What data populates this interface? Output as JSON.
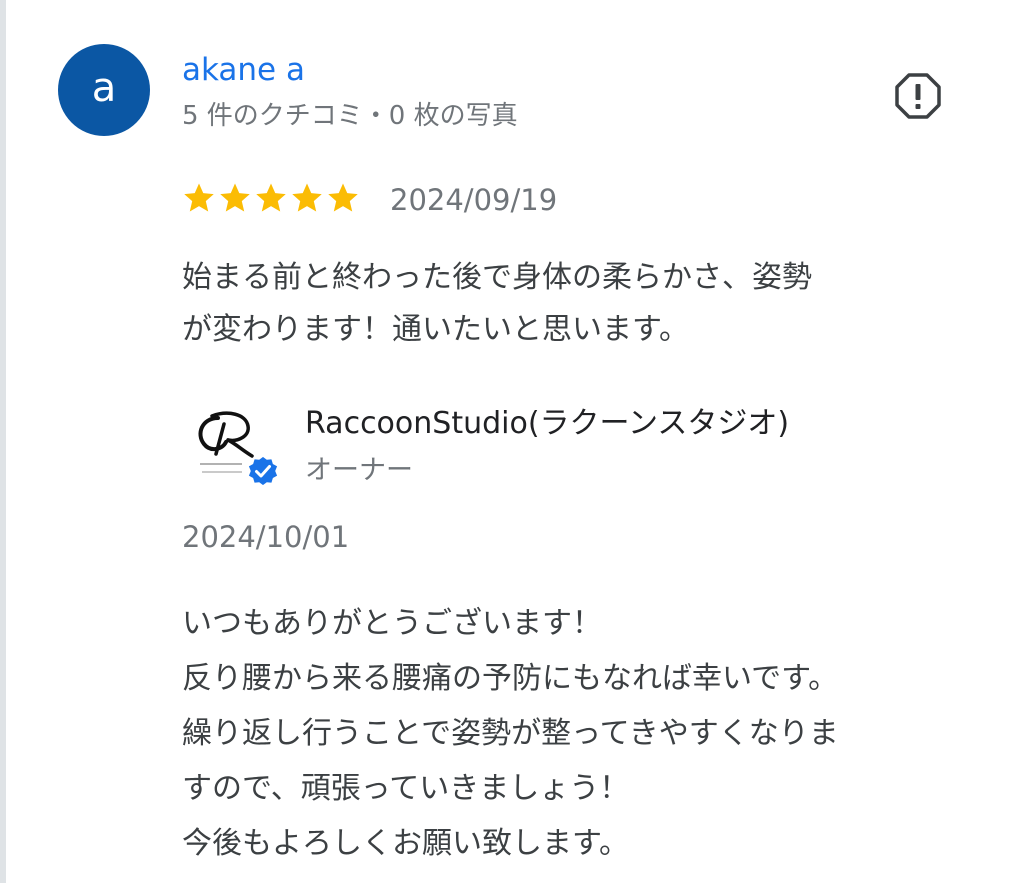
{
  "review": {
    "avatar_letter": "a",
    "avatar_color": "#0b57a4",
    "reviewer_name": "akane a",
    "reviewer_meta": "5 件のクチコミ・0 枚の写真",
    "report_icon": "report-flag-icon",
    "rating": 5,
    "rating_max": 5,
    "star_color": "#fbbc04",
    "date": "2024/09/19",
    "text": "始まる前と終わった後で身体の柔らかさ、姿勢\nが変わります！通いたいと思います。"
  },
  "owner_reply": {
    "owner_name": "RaccoonStudio(ラクーンスタジオ)",
    "owner_role": "オーナー",
    "verified_icon": "verified-badge-icon",
    "verified_color": "#1a73e8",
    "date": "2024/10/01",
    "text": "いつもありがとうございます！\n反り腰から来る腰痛の予防にもなれば幸いです。\n繰り返し行うことで姿勢が整ってきやすくなりま\nすので、頑張っていきましょう！\n今後もよろしくお願い致します。"
  },
  "colors": {
    "name_link": "#1a73e8",
    "secondary_text": "#70757a",
    "body_text": "#3c4043"
  }
}
